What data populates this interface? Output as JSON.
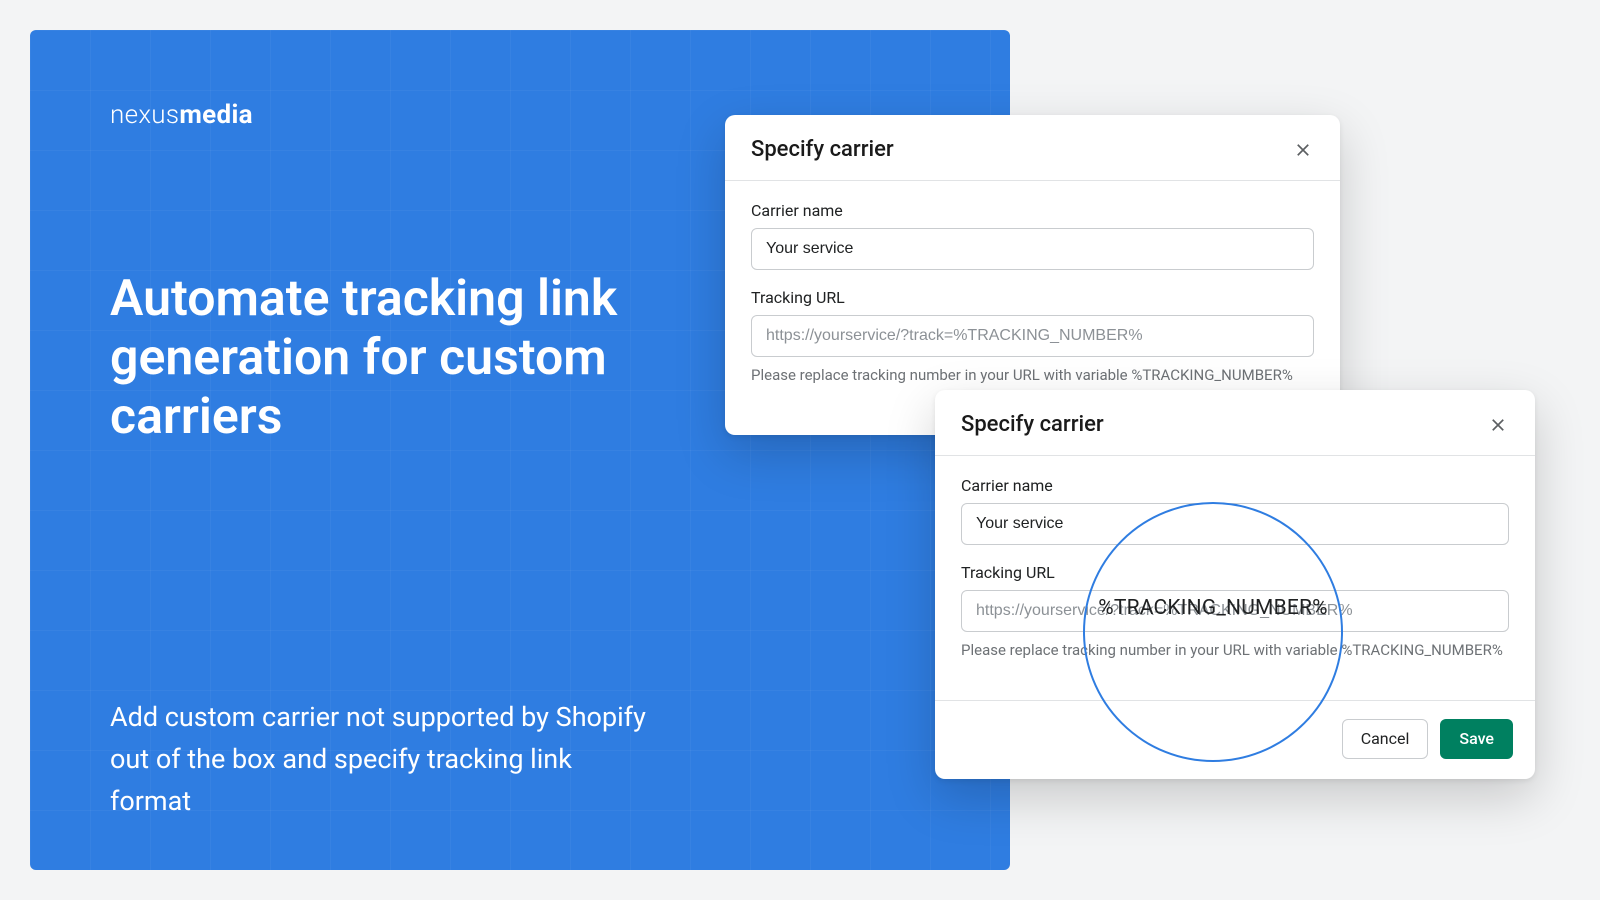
{
  "brand": {
    "line": "nexusmedia",
    "light": "nexus",
    "bold": "media"
  },
  "headline": "Automate tracking link generation for custom carriers",
  "sub": "Add custom carrier not supported by Shopify out of the box and specify tracking link format",
  "modal": {
    "title": "Specify carrier",
    "carrier_label": "Carrier name",
    "carrier_value": "Your service",
    "url_label": "Tracking URL",
    "url_placeholder": "https://yourservice/?track=%TRACKING_NUMBER%",
    "help": "Please replace tracking number in your URL with variable %TRACKING_NUMBER%",
    "cancel": "Cancel",
    "save": "Save"
  },
  "magnifier_text": "%TRACKING_NUMBER%"
}
